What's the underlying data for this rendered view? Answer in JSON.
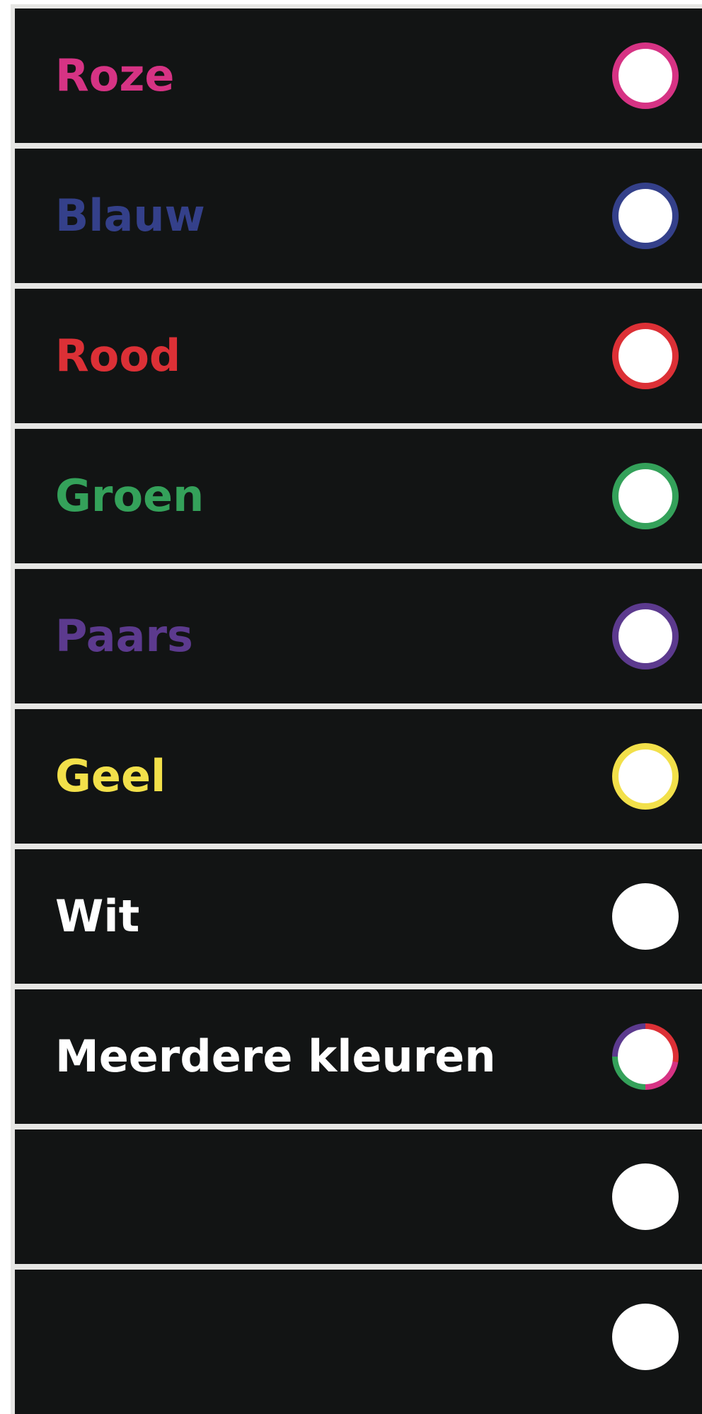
{
  "colors": [
    {
      "label": "Roze",
      "text_color": "#d63384",
      "ring_color": "#d63384"
    },
    {
      "label": "Blauw",
      "text_color": "#34408a",
      "ring_color": "#34408a"
    },
    {
      "label": "Rood",
      "text_color": "#dc3036",
      "ring_color": "#dc3036"
    },
    {
      "label": "Groen",
      "text_color": "#34a15a",
      "ring_color": "#34a15a"
    },
    {
      "label": "Paars",
      "text_color": "#5c3a8e",
      "ring_color": "#5c3a8e"
    },
    {
      "label": "Geel",
      "text_color": "#f2e04a",
      "ring_color": "#f2e04a"
    },
    {
      "label": "Wit",
      "text_color": "#ffffff",
      "ring_color": "#ffffff"
    },
    {
      "label": "Meerdere kleuren",
      "text_color": "#ffffff",
      "ring_color": "multi",
      "ring_colors": [
        "#dc3036",
        "#d63384",
        "#34a15a",
        "#5c3a8e"
      ]
    },
    {
      "label": "",
      "text_color": "#ffffff",
      "ring_color": "#ffffff"
    },
    {
      "label": "",
      "text_color": "#ffffff",
      "ring_color": "#ffffff"
    }
  ]
}
